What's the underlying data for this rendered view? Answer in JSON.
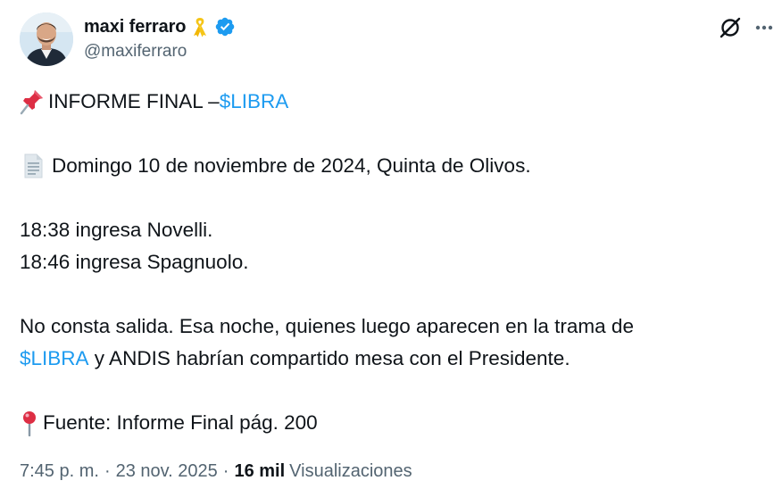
{
  "author": {
    "display_name": "maxi ferraro",
    "handle": "@maxiferraro",
    "ribbon": "yellow-ribbon-icon",
    "verified": "verified-badge-icon"
  },
  "actions": {
    "grok": "grok-icon",
    "more": "more-options-icon"
  },
  "tweet": {
    "line1_emoji": "pushpin-emoji",
    "line1_text": "INFORME FINAL – ",
    "line1_cashtag": "$LIBRA",
    "line2_emoji": "page-facing-up-emoji",
    "line2_text": "Domingo 10 de noviembre de 2024, Quinta de Olivos.",
    "line3_text": "18:38 ingresa Novelli.",
    "line4_text": "18:46 ingresa Spagnuolo.",
    "line5_text": "No consta salida. Esa noche, quienes luego aparecen en la trama de",
    "line6_cashtag": "$LIBRA",
    "line6_text": " y ANDIS habrían compartido mesa con el Presidente.",
    "line7_emoji": "round-pushpin-emoji",
    "line7_text": "Fuente: Informe Final pág. 200"
  },
  "meta": {
    "time": "7:45 p. m.",
    "separator": "·",
    "date": "23 nov. 2025",
    "views_count": "16 mil",
    "views_label": "Visualizaciones"
  },
  "colors": {
    "text": "#0f1419",
    "secondary": "#536471",
    "link": "#1d9bf0"
  }
}
